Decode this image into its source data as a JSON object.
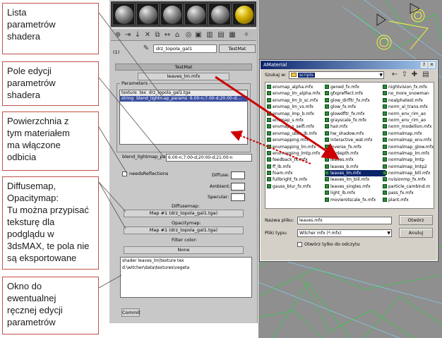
{
  "annotations": [
    {
      "id": "lista",
      "text": "Lista\nparametrów\nshadera"
    },
    {
      "id": "pole",
      "text": "Pole edycji\nparametrów\nshadera"
    },
    {
      "id": "powierzchnia",
      "text": "Powierzchnia z\ntym materiałem\nma włączone\nodbicia"
    },
    {
      "id": "diffuse",
      "text": "Diffusemap,\nOpacitymap:\nTu można przypisać\nteksturę dla\npodglądu w\n3dsMAX, te pola nie\nsą eksportowane"
    },
    {
      "id": "okno",
      "text": "Okno do\newentualnej\nręcznej edycji\nparametrów"
    }
  ],
  "material_editor": {
    "slot_count_label": "(1)",
    "material_name": "drz_topola_gal1",
    "material_type": "TestMat",
    "rollout_title": "TestMat",
    "shader_button": "leaves_lm.mfx",
    "parameters_label": "Parameters",
    "param_list": {
      "header": [
        "texture",
        "tex",
        "drz_topola_gal1.tga"
      ],
      "rows": [
        {
          "c1": "string",
          "c2": "blend_lightmap_params",
          "c3": "6.00-n;7.00-d;20.00-d;..."
        }
      ]
    },
    "edit_label": "blend_lightmap_pas",
    "edit_value": "6:00-n;7:00-d;20:00-d;21:00-n",
    "needs_reflections_label": "needsReflections",
    "diffuse_label": "Diffuse:",
    "ambient_label": "Ambient:",
    "specular_label": "Specular:",
    "diffusemap_title": "Diffusemap:",
    "diffusemap_button": "Map #1 (drz_topola_gal1.tga)",
    "opacitymap_title": "Opacitymap:",
    "opacitymap_button": "Map #1 (drz_topola_gal1.tga)",
    "filter_color_title": "Filter color:",
    "filter_color_button": "None",
    "shader_text": "shader leaves_lm|texture tex d:\\witcher\\data\\textures\\vegeta",
    "commit_button": "Commit"
  },
  "dialog": {
    "title": "AMaterial",
    "lookin_label": "Szukaj w:",
    "lookin_value": "scripts",
    "columns": [
      [
        "envmap_alpha.mfx",
        "envmap_lm_alpha.mfx",
        "envmap_lm_b_sc.mfx",
        "envmap_lm_vs.mfx",
        "envmap_lmp_b.mfx",
        "envmap_s.mfx",
        "envmap_s_selfi.mfx",
        "envmap_uber_lb.mfx",
        "envmapping.mfx",
        "envmapping_lm.mfx",
        "envmapping_lmtp.mfx",
        "feedback_fx.mfx",
        "ff_lb.mfx",
        "foam.mfx",
        "fullbright_fx.mfx",
        "gauss_blur_fx.mfx"
      ],
      [
        "gened_fx.mfx",
        "gfxpreffect.mfx",
        "glow_dirfltr_fx.mfx",
        "glow_fx.mfx",
        "glowdfltr_fx.mfx",
        "grayscale_fx.mfx",
        "hair.mfx",
        "hw_shadow.mfx",
        "interactive_wat.mfx",
        "inverse_fx.mfx",
        "laydepth.mfx",
        "leaves.mfx",
        "leaves_b.mfx",
        "leaves_lm.mfx",
        "leaves_lm_bill.mfx",
        "leaves_singles.mfx",
        "light_lb.mfx",
        "movierotscale_fx.mfx"
      ],
      [
        "nightvision_fx.mfx",
        "no_more_snowman",
        "noalphatest.mfx",
        "norm_al_trans.mfx",
        "norm_env_rim_ao",
        "norm_env_rim_ao",
        "norm_modellion.mfx",
        "normalmap.mfx",
        "normalmap_env.mfx",
        "normalmap_glow.mfx",
        "normalmap_lm.mfx",
        "normalmap_lmtp",
        "normalmap_lmtp2",
        "normalmap_bill.mfx",
        "nvisionmp_fx.mfx",
        "particle_cambind.m",
        "pass_fx.mfx",
        "plant.mfx"
      ]
    ],
    "selected_file": "leaves_lm.mfx",
    "filename_label": "Nazwa pliku:",
    "filename_value": "leaves.mfx",
    "filetype_label": "Pliki typu:",
    "filetype_value": "Witcher mfx (*.mfx)",
    "readonly_label": "Otwórz tylko do odczytu",
    "open_button": "Otwórz",
    "cancel_button": "Anuluj"
  },
  "colors": {
    "annotation_border": "#c0504d",
    "arrow": "#cc0000",
    "title_bar": "#0a246a",
    "selection": "#0a246a"
  }
}
